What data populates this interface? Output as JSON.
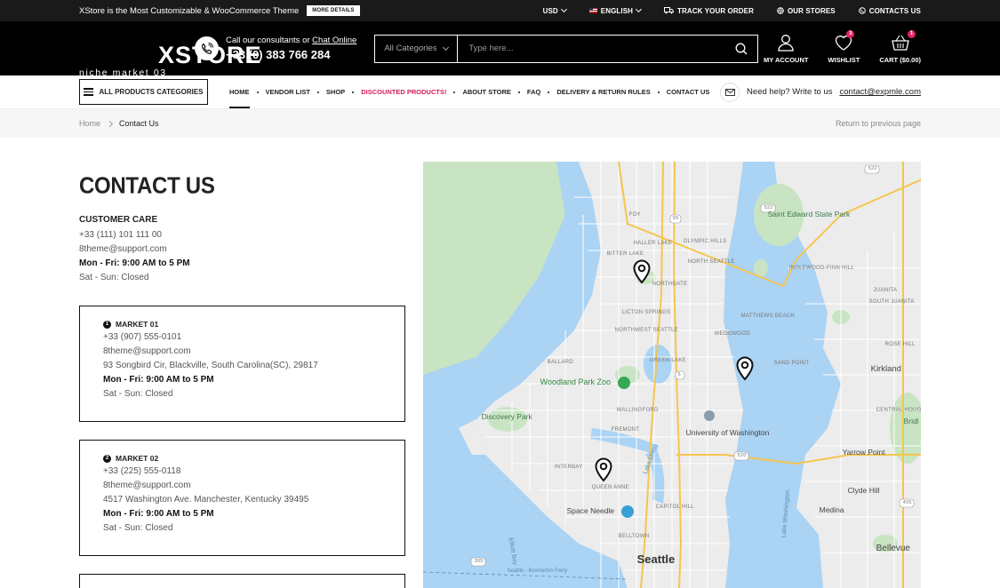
{
  "topbar": {
    "promo": "XStore is the Most Customizable & WooCommerce Theme",
    "more_btn": "MORE DETAILS",
    "currency": "USD",
    "language": "ENGLISH",
    "track": "TRACK YOUR ORDER",
    "stores": "OUR STORES",
    "contacts": "CONTACTS US"
  },
  "header": {
    "logo_main": "XSTORE",
    "logo_sub": "niche market 03",
    "consult_text": "Call our consultants or",
    "consult_link": "Chat Online",
    "phone": "+33 (0) 383 766 284",
    "search_category": "All Categories",
    "search_placeholder": "Type here...",
    "account": "MY ACCOUNT",
    "wishlist": "WISHLIST",
    "wishlist_count": "3",
    "cart": "CART ($0.00)",
    "cart_count": "1"
  },
  "nav": {
    "all_categories": "ALL PRODUCTS CATEGORIES",
    "items": [
      "HOME",
      "VENDOR LIST",
      "SHOP",
      "DISCOUNTED PRODUCTS!",
      "ABOUT STORE",
      "FAQ",
      "DELIVERY & RETURN RULES",
      "CONTACT US"
    ],
    "help_text": "Need help? Write to us",
    "help_email": "contact@expmle.com"
  },
  "breadcrumb": {
    "home": "Home",
    "current": "Contact Us",
    "back": "Return to previous page"
  },
  "content": {
    "title": "CONTACT US",
    "care": {
      "title": "CUSTOMER CARE",
      "phone": "+33 (111) 101 111 00",
      "email": "8theme@support.com",
      "hours": "Mon - Fri: 9:00 AM to 5 PM",
      "weekend": "Sat - Sun: Closed"
    },
    "markets": [
      {
        "num": "1",
        "title": "MARKET 01",
        "phone": "+33 (907) 555-0101",
        "email": "8theme@support.com",
        "address": "93 Songbird Cir, Blackville, South Carolina(SC), 29817",
        "hours": "Mon - Fri: 9:00 AM to 5 PM",
        "weekend": "Sat - Sun: Closed"
      },
      {
        "num": "2",
        "title": "MARKET 02",
        "phone": "+33 (225) 555-0118",
        "email": "8theme@support.com",
        "address": "4517 Washington Ave. Manchester, Kentucky 39495",
        "hours": "Mon - Fri: 9:00 AM to 5 PM",
        "weekend": "Sat - Sun: Closed"
      }
    ]
  },
  "map": {
    "labels": {
      "saint_edward": "Saint Edward State Park",
      "foy": "FOY",
      "haller_lake": "HALLER LAKE",
      "olympic_hills": "OLYMPIC HILLS",
      "bitter_lake": "BITTER LAKE",
      "north_seattle": "NORTH SEATTLE",
      "inglewood": "INGLEWOOD-FINN HILL",
      "juanita": "JUANITA",
      "south_juanita": "SOUTH JUANITA",
      "northgate": "NORTHGATE",
      "matthews": "MATTHEWS BEACH",
      "licton": "LICTON SPRINGS",
      "northwest_seattle": "NORTHWEST SEATTLE",
      "wedgwood": "WEDGWOOD",
      "rose_hill": "ROSE HILL",
      "ballard": "BALLARD",
      "green_lake": "GREEN LAKE",
      "sand_point": "SAND POINT",
      "kirkland": "Kirkland",
      "woodland_zoo": "Woodland Park Zoo",
      "central_houghton": "CENTRAL HOUGHTON",
      "discovery_park": "Discovery Park",
      "wallingford": "WALLINGFORD",
      "uw": "University of Washington",
      "fremont": "FREMONT",
      "bridle": "Bridl Trai State",
      "interbay": "INTERBAY",
      "yarrow_point": "Yarrow Point",
      "clyde_hill": "Clyde Hill",
      "queen_anne": "QUEEN ANNE",
      "lake_union": "Lake Union",
      "lake_washington": "Lake Washington",
      "space_needle": "Space Needle",
      "capitol_hill": "CAPITOL HILL",
      "medina": "Medina",
      "elliott_bay": "Elliott Bay",
      "belltown": "BELLTOWN",
      "seattle": "Seattle",
      "bellevue": "Bellevue",
      "ferry": "Seattle - Bremerton Ferry",
      "r522a": "522",
      "r522b": "522",
      "r405": "405",
      "r305": "305",
      "r520": "520",
      "r99": "99",
      "r5": "5"
    }
  }
}
